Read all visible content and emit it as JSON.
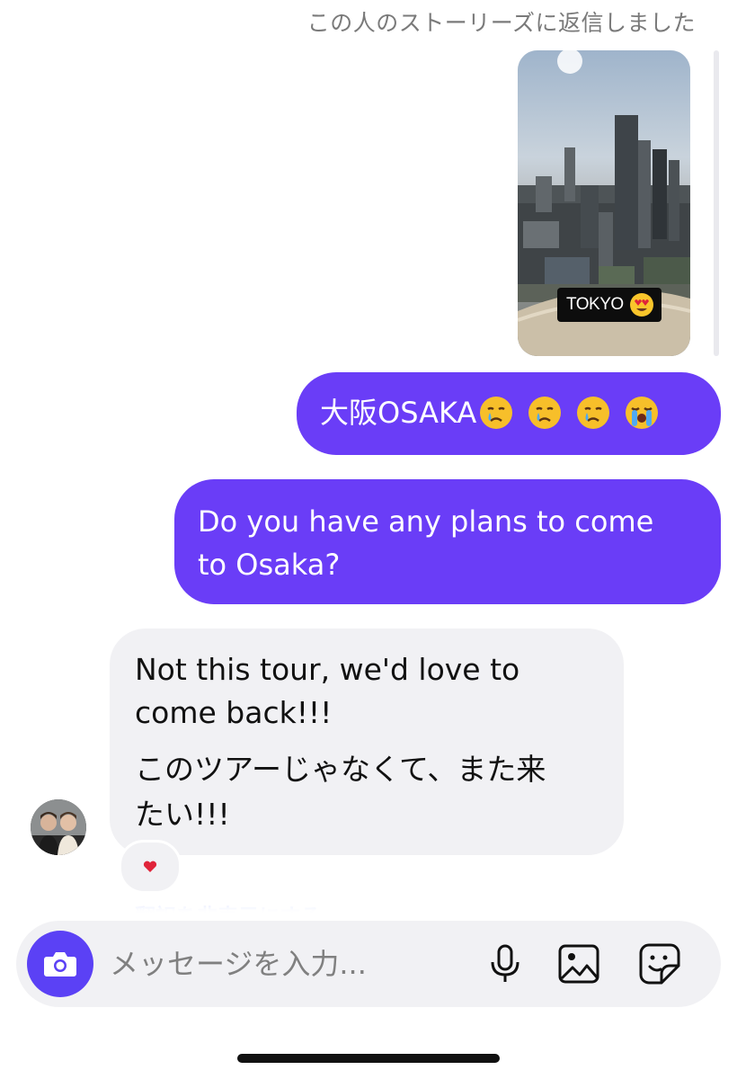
{
  "chat": {
    "story_reply_note": "この人のストーリーズに返信しました",
    "story_sticker_text": "TOKYO",
    "messages": {
      "outgoing_1": "大阪OSAKA",
      "outgoing_2_line1": "Do you have any plans to come",
      "outgoing_2_line2": "to Osaka?",
      "incoming_en_line1": "Not this tour, we'd love to",
      "incoming_en_line2": "come back!!!",
      "incoming_ja_line1": "このツアーじゃなくて、また来",
      "incoming_ja_line2": "たい!!!"
    },
    "reaction": "heart",
    "translate_toggle": "翻訳を非表示にする"
  },
  "composer": {
    "placeholder": "メッセージを入力..."
  },
  "icons": {
    "camera": "camera-icon",
    "mic": "microphone-icon",
    "gallery": "image-gallery-icon",
    "sticker": "sticker-icon",
    "crying_face": "crying-face-emoji",
    "loudly_crying_face": "loudly-crying-face-emoji",
    "heart_eyes": "heart-eyes-emoji"
  },
  "colors": {
    "outgoing_bubble": "#6a3df7",
    "incoming_bubble": "#f1f1f4",
    "camera_button": "#5b41f5",
    "link": "#4b6cf2"
  }
}
